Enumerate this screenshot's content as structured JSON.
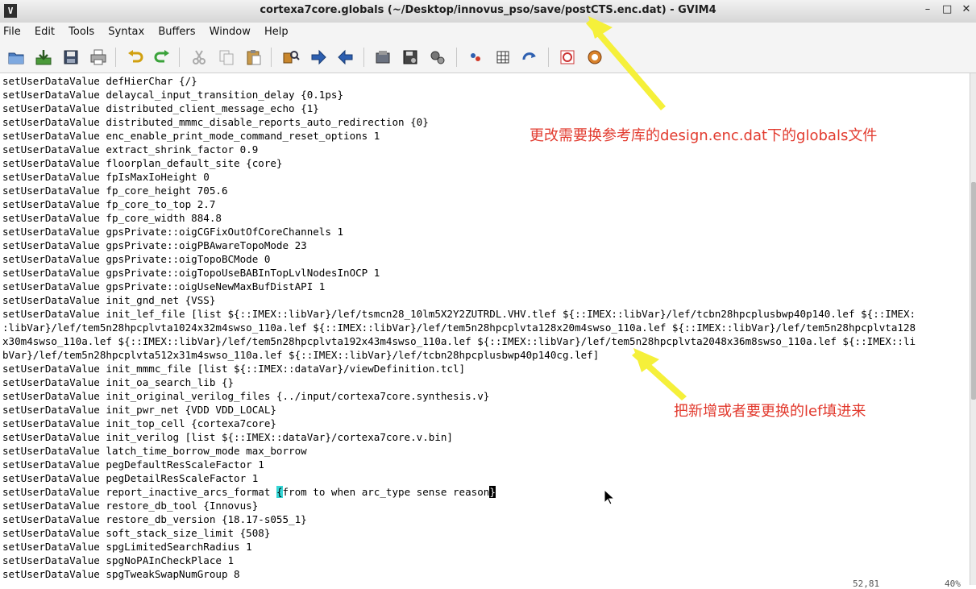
{
  "window": {
    "title": "cortexa7core.globals (~/Desktop/innovus_pso/save/postCTS.enc.dat) - GVIM4",
    "app_icon": "V",
    "controls": [
      "–",
      "□",
      "✕"
    ]
  },
  "menu": [
    "File",
    "Edit",
    "Tools",
    "Syntax",
    "Buffers",
    "Window",
    "Help"
  ],
  "toolbar_icons": [
    "open-icon",
    "save-download-icon",
    "save-icon",
    "print-icon",
    "undo-icon",
    "redo-icon",
    "cut-icon",
    "copy-icon",
    "paste-icon",
    "find-replace-icon",
    "forward-icon",
    "back-icon",
    "load-session-icon",
    "save-session-icon",
    "run-script-icon",
    "make-icon",
    "table-icon",
    "jump-icon",
    "help-icon",
    "find-help-icon"
  ],
  "lines": [
    "setUserDataValue defHierChar {/}",
    "setUserDataValue delaycal_input_transition_delay {0.1ps}",
    "setUserDataValue distributed_client_message_echo {1}",
    "setUserDataValue distributed_mmmc_disable_reports_auto_redirection {0}",
    "setUserDataValue enc_enable_print_mode_command_reset_options 1",
    "setUserDataValue extract_shrink_factor 0.9",
    "setUserDataValue floorplan_default_site {core}",
    "setUserDataValue fpIsMaxIoHeight 0",
    "setUserDataValue fp_core_height 705.6",
    "setUserDataValue fp_core_to_top 2.7",
    "setUserDataValue fp_core_width 884.8",
    "setUserDataValue gpsPrivate::oigCGFixOutOfCoreChannels 1",
    "setUserDataValue gpsPrivate::oigPBAwareTopoMode 23",
    "setUserDataValue gpsPrivate::oigTopoBCMode 0",
    "setUserDataValue gpsPrivate::oigTopoUseBABInTopLvlNodesInOCP 1",
    "setUserDataValue gpsPrivate::oigUseNewMaxBufDistAPI 1",
    "setUserDataValue init_gnd_net {VSS}",
    "setUserDataValue init_lef_file [list ${::IMEX::libVar}/lef/tsmcn28_10lm5X2Y2ZUTRDL.VHV.tlef ${::IMEX::libVar}/lef/tcbn28hpcplusbwp40p140.lef ${::IMEX:",
    ":libVar}/lef/tem5n28hpcplvta1024x32m4swso_110a.lef ${::IMEX::libVar}/lef/tem5n28hpcplvta128x20m4swso_110a.lef ${::IMEX::libVar}/lef/tem5n28hpcplvta128",
    "x30m4swso_110a.lef ${::IMEX::libVar}/lef/tem5n28hpcplvta192x43m4swso_110a.lef ${::IMEX::libVar}/lef/tem5n28hpcplvta2048x36m8swso_110a.lef ${::IMEX::li",
    "bVar}/lef/tem5n28hpcplvta512x31m4swso_110a.lef ${::IMEX::libVar}/lef/tcbn28hpcplusbwp40p140cg.lef]",
    "setUserDataValue init_mmmc_file [list ${::IMEX::dataVar}/viewDefinition.tcl]",
    "setUserDataValue init_oa_search_lib {}",
    "setUserDataValue init_original_verilog_files {../input/cortexa7core.synthesis.v}",
    "setUserDataValue init_pwr_net {VDD VDD_LOCAL}",
    "setUserDataValue init_top_cell {cortexa7core}",
    "setUserDataValue init_verilog [list ${::IMEX::dataVar}/cortexa7core.v.bin]",
    "setUserDataValue latch_time_borrow_mode max_borrow",
    "setUserDataValue pegDefaultResScaleFactor 1",
    "setUserDataValue pegDetailResScaleFactor 1",
    "__SPECIAL__",
    "setUserDataValue restore_db_tool {Innovus}",
    "setUserDataValue restore_db_version {18.17-s055_1}",
    "setUserDataValue soft_stack_size_limit {508}",
    "setUserDataValue spgLimitedSearchRadius 1",
    "setUserDataValue spgNoPAInCheckPlace 1",
    "setUserDataValue spgTweakSwapNumGroup 8"
  ],
  "special_line": {
    "prefix": "setUserDataValue report_inactive_arcs_format ",
    "open_brace": "{",
    "middle": "from to when arc_type sense reason",
    "close_brace": "}"
  },
  "annotations": {
    "top": "更改需要换参考库的design.enc.dat下的globals文件",
    "middle": "把新增或者要更换的lef填进来",
    "color": "#e23a2e",
    "arrow_color": "#f5f03a"
  },
  "status": {
    "position": "52,81",
    "percent": "40%"
  }
}
